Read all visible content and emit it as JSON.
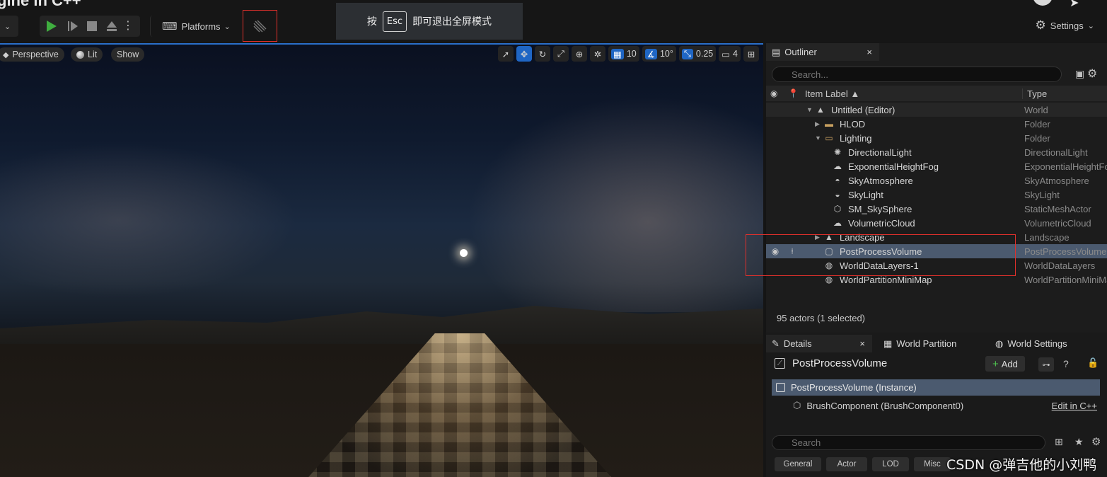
{
  "window": {
    "title_fragment": "gine in C++"
  },
  "toolbar": {
    "platforms_label": "Platforms",
    "settings_label": "Settings",
    "esc_notice": {
      "prefix": "按",
      "key": "Esc",
      "suffix": "即可退出全屏模式"
    }
  },
  "viewport": {
    "perspective_label": "Perspective",
    "lit_label": "Lit",
    "show_label": "Show",
    "grid_snap": "10",
    "rotation_snap": "10°",
    "scale_snap": "0.25",
    "camera_speed": "4"
  },
  "outliner": {
    "tab_label": "Outliner",
    "search_placeholder": "Search...",
    "columns": {
      "label": "Item Label ▲",
      "type": "Type"
    },
    "rows": [
      {
        "label": "Untitled (Editor)",
        "type": "World",
        "icon": "world-icon",
        "indent": 1,
        "arrow": "down"
      },
      {
        "label": "HLOD",
        "type": "Folder",
        "icon": "folder-icon",
        "indent": 2,
        "arrow": "right"
      },
      {
        "label": "Lighting",
        "type": "Folder",
        "icon": "folder-open-icon",
        "indent": 2,
        "arrow": "down"
      },
      {
        "label": "DirectionalLight",
        "type": "DirectionalLight",
        "icon": "sun-icon",
        "indent": 3
      },
      {
        "label": "ExponentialHeightFog",
        "type": "ExponentialHeightFog",
        "icon": "fog-icon",
        "indent": 3
      },
      {
        "label": "SkyAtmosphere",
        "type": "SkyAtmosphere",
        "icon": "atmosphere-icon",
        "indent": 3
      },
      {
        "label": "SkyLight",
        "type": "SkyLight",
        "icon": "skylight-icon",
        "indent": 3
      },
      {
        "label": "SM_SkySphere",
        "type": "StaticMeshActor",
        "icon": "mesh-icon",
        "indent": 3
      },
      {
        "label": "VolumetricCloud",
        "type": "VolumetricCloud",
        "icon": "cloud-icon",
        "indent": 3
      },
      {
        "label": "Landscape",
        "type": "Landscape",
        "icon": "landscape-icon",
        "indent": 2,
        "arrow": "right"
      },
      {
        "label": "PostProcessVolume",
        "type": "PostProcessVolume",
        "icon": "postprocess-icon",
        "indent": 2,
        "selected": true
      },
      {
        "label": "WorldDataLayers-1",
        "type": "WorldDataLayers",
        "icon": "globe-icon",
        "indent": 2
      },
      {
        "label": "WorldPartitionMiniMap",
        "type": "WorldPartitionMiniMap",
        "icon": "globe-icon",
        "indent": 2
      }
    ],
    "actor_count": "95 actors (1 selected)"
  },
  "details": {
    "tabs": [
      "Details",
      "World Partition",
      "World Settings"
    ],
    "object_name": "PostProcessVolume",
    "add_label": "Add",
    "instance_label": "PostProcessVolume (Instance)",
    "component_label": "BrushComponent (BrushComponent0)",
    "edit_link": "Edit in C++",
    "search_placeholder": "Search",
    "filters": [
      "General",
      "Actor",
      "LOD",
      "Misc"
    ]
  },
  "watermark": "CSDN @弹吉他的小刘鸭",
  "colors": {
    "accent": "#1f66c4",
    "selection": "#4b5a6f",
    "play": "#3fae3f",
    "highlight_box": "#e0302c"
  }
}
